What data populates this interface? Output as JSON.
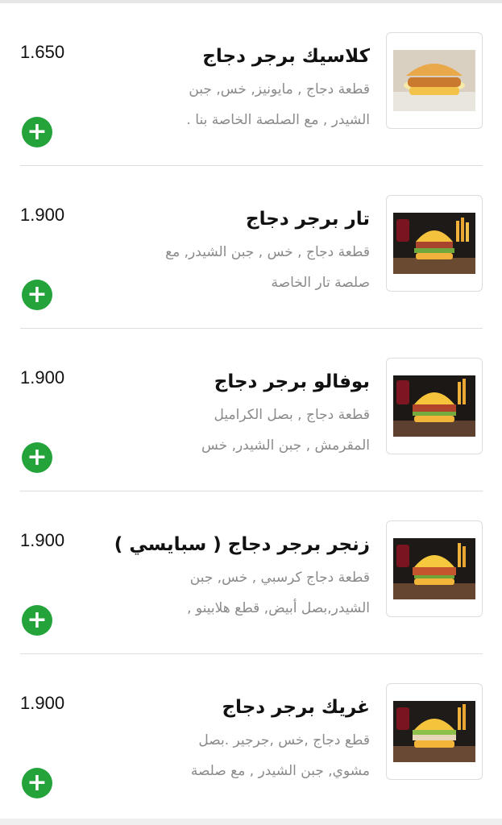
{
  "items": [
    {
      "price": "1.650",
      "title": "كلاسيك برجر  دجاج",
      "desc_line1": "قطعة دجاج , مايونيز, خس, جبن",
      "desc_line2": "الشيدر , مع الصلصة الخاصة بنا .",
      "add_label": "+",
      "image_icon": "classic-chicken-burger-photo"
    },
    {
      "price": "1.900",
      "title": "تار برجر دجاج",
      "desc_line1": "قطعة دجاج , خس , جبن الشيدر, مع",
      "desc_line2": "صلصة تار الخاصة",
      "add_label": "+",
      "image_icon": "tar-chicken-burger-photo"
    },
    {
      "price": "1.900",
      "title": "بوفالو برجر دجاج",
      "desc_line1": "قطعة دجاج , بصل الكراميل",
      "desc_line2": "المقرمش , جبن الشيدر, خس",
      "add_label": "+",
      "image_icon": "buffalo-chicken-burger-photo"
    },
    {
      "price": "1.900",
      "title": "زنجر برجر دجاج  ( سبايسي )",
      "desc_line1": "قطعة دجاج كرسبي , خس, جبن",
      "desc_line2": "الشيدر,بصل أبيض,  قطع هلابينو ,",
      "add_label": "+",
      "image_icon": "zinger-chicken-burger-photo"
    },
    {
      "price": "1.900",
      "title": "غريك برجر دجاج",
      "desc_line1": "قطع دجاج ,خس ,جرجير .بصل",
      "desc_line2": "مشوي, جبن الشيدر , مع صلصة",
      "add_label": "+",
      "image_icon": "greek-chicken-burger-photo"
    }
  ],
  "colors": {
    "add_button": "#23a33a",
    "price_text": "#111111",
    "description_text": "#8a8a8a",
    "divider": "#dedede"
  }
}
